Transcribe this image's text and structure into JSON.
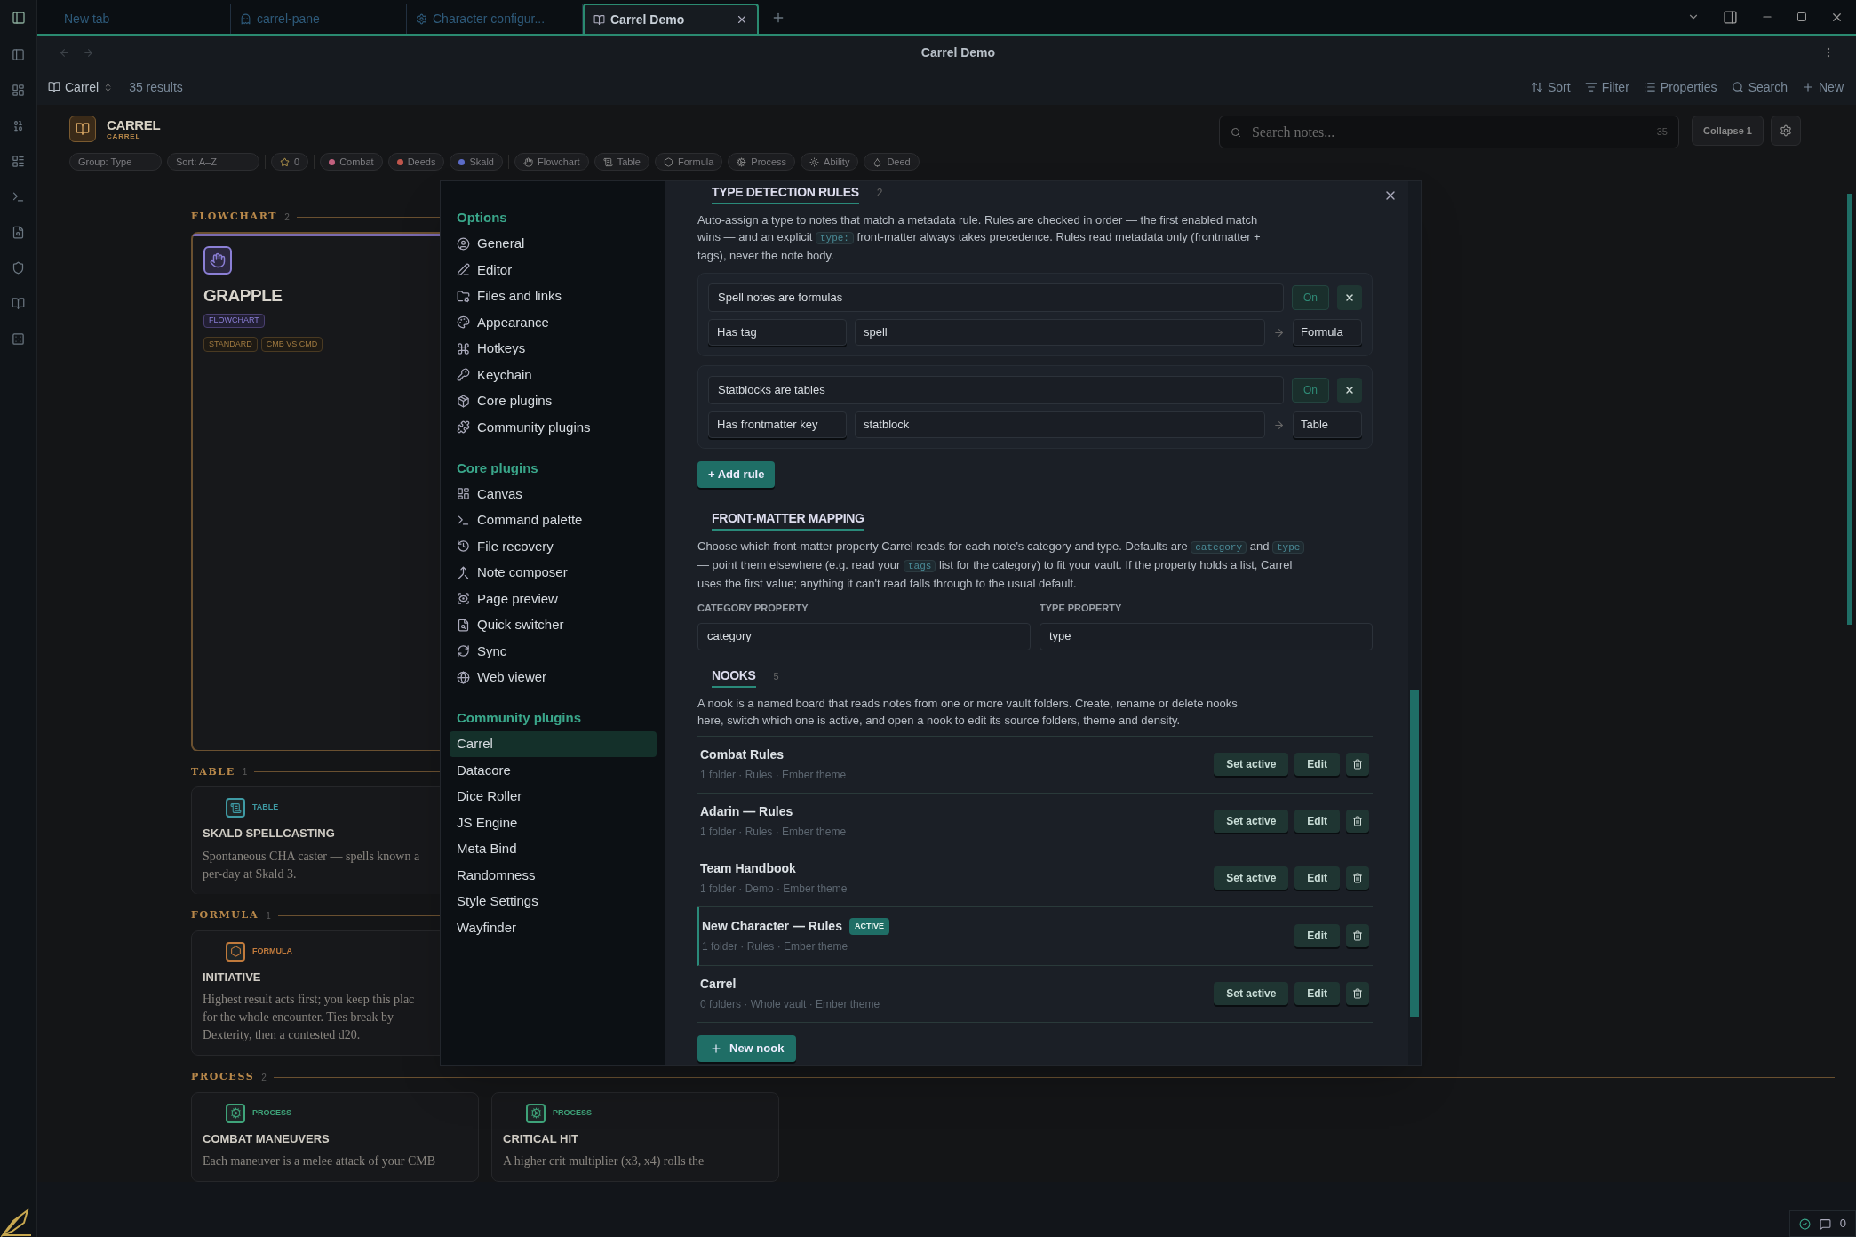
{
  "tabs": [
    {
      "label": "New tab",
      "kind": "plain",
      "selected": false
    },
    {
      "label": "carrel-pane",
      "kind": "ghost",
      "selected": false
    },
    {
      "label": "Character configur...",
      "kind": "gear",
      "selected": false
    },
    {
      "label": "Carrel Demo",
      "kind": "book",
      "selected": true
    }
  ],
  "view_title": "Carrel Demo",
  "view_header": {
    "source": "Carrel",
    "results": "35 results",
    "actions": [
      "Sort",
      "Filter",
      "Properties",
      "Search",
      "New"
    ]
  },
  "board": {
    "title": "CARREL",
    "subtitle": "CARREL",
    "search": {
      "placeholder": "Search notes...",
      "count": "35"
    },
    "collapse": "Collapse 1",
    "chips": [
      {
        "label": "Group: Type",
        "kind": "plain"
      },
      {
        "label": "Sort: A–Z",
        "kind": "plain"
      },
      {
        "label": "0",
        "kind": "star"
      },
      {
        "label": "Combat",
        "kind": "dot",
        "color": "#c2607e"
      },
      {
        "label": "Deeds",
        "kind": "dot",
        "color": "#c0564c"
      },
      {
        "label": "Skald",
        "kind": "dot",
        "color": "#5c6cc8"
      },
      {
        "label": "Flowchart",
        "kind": "type"
      },
      {
        "label": "Table",
        "kind": "type"
      },
      {
        "label": "Formula",
        "kind": "type"
      },
      {
        "label": "Process",
        "kind": "type"
      },
      {
        "label": "Ability",
        "kind": "type"
      },
      {
        "label": "Deed",
        "kind": "type"
      }
    ],
    "sections": [
      {
        "title": "FLOWCHART",
        "count": "2",
        "kind": "tall",
        "cards": [
          {
            "title": "GRAPPLE",
            "type": "FLOWCHART",
            "color": "#8b7fd6",
            "tags": [
              "STANDARD",
              "CMB VS CMD"
            ]
          }
        ]
      },
      {
        "title": "TABLE",
        "count": "1",
        "kind": "narrow",
        "cards": [
          {
            "title": "SKALD SPELLCASTING",
            "type": "TABLE",
            "color": "#3f9aa4",
            "lines": [
              "Spontaneous CHA caster — spells known a",
              "per-day at Skald 3."
            ]
          }
        ]
      },
      {
        "title": "FORMULA",
        "count": "1",
        "kind": "narrow",
        "cards": [
          {
            "title": "INITIATIVE",
            "type": "FORMULA",
            "color": "#c07a3c",
            "lines": [
              "Highest result acts first; you keep this plac",
              "for the whole encounter. Ties break by",
              "Dexterity, then a contested d20."
            ]
          }
        ]
      },
      {
        "title": "PROCESS",
        "count": "2",
        "kind": "wide",
        "cards": [
          {
            "title": "COMBAT MANEUVERS",
            "type": "PROCESS",
            "color": "#3fa47a",
            "lines": [
              "Each maneuver is a melee attack of your CMB"
            ]
          },
          {
            "title": "CRITICAL HIT",
            "type": "PROCESS",
            "color": "#3fa47a",
            "lines": [
              "A higher crit multiplier (x3, x4) rolls the"
            ]
          }
        ]
      }
    ]
  },
  "settings_nav": [
    {
      "title": "Options",
      "items": [
        {
          "label": "General",
          "selected": false
        },
        {
          "label": "Editor",
          "selected": false
        },
        {
          "label": "Files and links",
          "selected": false
        },
        {
          "label": "Appearance",
          "selected": false
        },
        {
          "label": "Hotkeys",
          "selected": false
        },
        {
          "label": "Keychain",
          "selected": false
        },
        {
          "label": "Core plugins",
          "selected": false
        },
        {
          "label": "Community plugins",
          "selected": false
        }
      ]
    },
    {
      "title": "Core plugins",
      "items": [
        {
          "label": "Canvas",
          "selected": false
        },
        {
          "label": "Command palette",
          "selected": false
        },
        {
          "label": "File recovery",
          "selected": false
        },
        {
          "label": "Note composer",
          "selected": false
        },
        {
          "label": "Page preview",
          "selected": false
        },
        {
          "label": "Quick switcher",
          "selected": false
        },
        {
          "label": "Sync",
          "selected": false
        },
        {
          "label": "Web viewer",
          "selected": false
        }
      ]
    },
    {
      "title": "Community plugins",
      "items": [
        {
          "label": "Carrel",
          "selected": true
        },
        {
          "label": "Datacore",
          "selected": false
        },
        {
          "label": "Dice Roller",
          "selected": false
        },
        {
          "label": "JS Engine",
          "selected": false
        },
        {
          "label": "Meta Bind",
          "selected": false
        },
        {
          "label": "Randomness",
          "selected": false
        },
        {
          "label": "Style Settings",
          "selected": false
        },
        {
          "label": "Wayfinder",
          "selected": false
        }
      ]
    }
  ],
  "type_rules": {
    "title": "TYPE DETECTION RULES",
    "count": "2",
    "description": [
      {
        "kind": "text",
        "text": "Auto-assign a type to notes that match a metadata rule. Rules are checked in order — the first enabled match wins — and an explicit "
      },
      {
        "kind": "code",
        "text": "type:"
      },
      {
        "kind": "text",
        "text": " front-matter always takes precedence. Rules read metadata only (frontmatter + tags), never the note body."
      }
    ],
    "rules": [
      {
        "name": "Spell notes are formulas",
        "toggle": "On",
        "on": true,
        "condition": "Has tag",
        "value": "spell",
        "target": "Formula"
      },
      {
        "name": "Statblocks are tables",
        "toggle": "On",
        "on": true,
        "condition": "Has frontmatter key",
        "value": "statblock",
        "target": "Table"
      }
    ],
    "add_button": "+ Add rule"
  },
  "front_matter": {
    "title": "FRONT-MATTER MAPPING",
    "description": [
      {
        "kind": "text",
        "text": "Choose which front-matter property Carrel reads for each note's category and type. Defaults are "
      },
      {
        "kind": "code",
        "text": "category"
      },
      {
        "kind": "text",
        "text": " and "
      },
      {
        "kind": "code",
        "text": "type"
      },
      {
        "kind": "text",
        "text": " — point them elsewhere (e.g. read your "
      },
      {
        "kind": "code",
        "text": "tags"
      },
      {
        "kind": "text",
        "text": " list for the category) to fit your vault. If the property holds a list, Carrel uses the first value; anything it can't read falls through to the usual default."
      }
    ],
    "fields": [
      {
        "label": "CATEGORY PROPERTY",
        "value": "category"
      },
      {
        "label": "TYPE PROPERTY",
        "value": "type"
      }
    ]
  },
  "nooks": {
    "title": "NOOKS",
    "count": "5",
    "description": "A nook is a named board that reads notes from one or more vault folders. Create, rename or delete nooks here, switch which one is active, and open a nook to edit its source folders, theme and density.",
    "items": [
      {
        "name": "Combat Rules",
        "meta": "1 folder · Rules · Ember theme",
        "active": false,
        "buttons": [
          "Set active",
          "Edit"
        ]
      },
      {
        "name": "Adarin — Rules",
        "meta": "1 folder · Rules · Ember theme",
        "active": false,
        "buttons": [
          "Set active",
          "Edit"
        ]
      },
      {
        "name": "Team Handbook",
        "meta": "1 folder · Demo · Ember theme",
        "active": false,
        "buttons": [
          "Set active",
          "Edit"
        ]
      },
      {
        "name": "New Character — Rules",
        "badge": "ACTIVE",
        "meta": "1 folder · Rules · Ember theme",
        "active": true,
        "buttons": [
          "Edit"
        ]
      },
      {
        "name": "Carrel",
        "meta": "0 folders · Whole vault · Ember theme",
        "active": false,
        "buttons": [
          "Set active",
          "Edit"
        ]
      }
    ],
    "new_button": "New nook"
  },
  "status_bar": {
    "count": "0"
  }
}
